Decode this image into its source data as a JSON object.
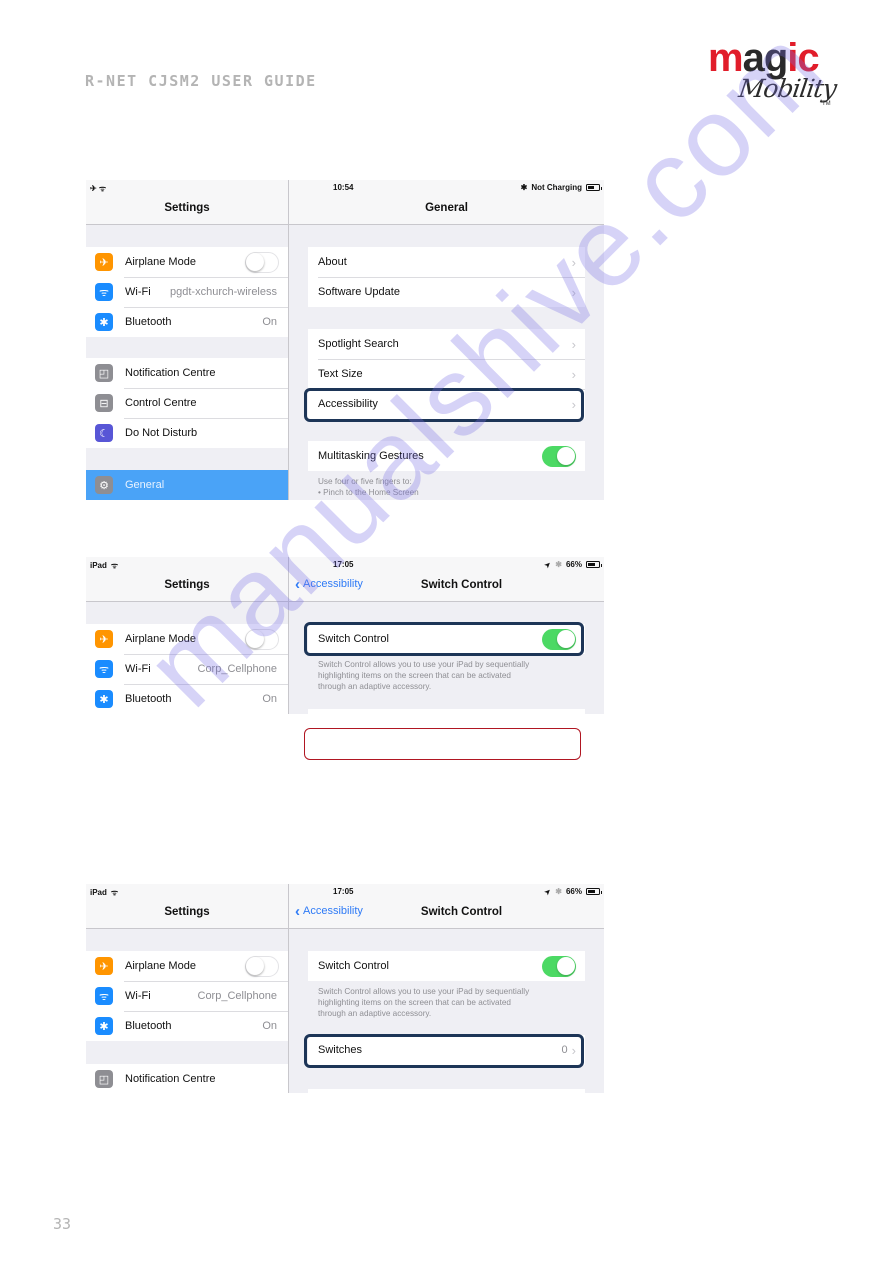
{
  "document": {
    "header_title": "R-NET CJSM2 USER GUIDE",
    "page_number": "33",
    "logo": {
      "word1_a": "m",
      "word1_b": "ag",
      "word1_c": "ic",
      "word2": "Mobility",
      "tm": "TM"
    },
    "watermark": "manualshive.com",
    "colors": {
      "brand_red": "#e11d2a",
      "highlight_navy": "#1d3557",
      "ios_blue": "#2f7bf6",
      "ios_green": "#4cd964",
      "annotation_red": "#b01622"
    }
  },
  "screenshot1": {
    "status": {
      "left_icons": "✈ ᯤ",
      "time": "10:54",
      "bluetooth": "✱",
      "charging": "Not Charging"
    },
    "left": {
      "title": "Settings",
      "group1": [
        {
          "icon": "airplane-icon",
          "glyph": "✈",
          "label": "Airplane Mode",
          "toggle": "off"
        },
        {
          "icon": "wifi-icon",
          "glyph": "ᯤ",
          "label": "Wi-Fi",
          "value": "pgdt-xchurch-wireless"
        },
        {
          "icon": "bluetooth-icon",
          "glyph": "✱",
          "label": "Bluetooth",
          "value": "On"
        }
      ],
      "group2": [
        {
          "icon": "notification-centre-icon",
          "glyph": "◰",
          "label": "Notification Centre"
        },
        {
          "icon": "control-centre-icon",
          "glyph": "⊟",
          "label": "Control Centre"
        },
        {
          "icon": "do-not-disturb-icon",
          "glyph": "☾",
          "label": "Do Not Disturb"
        }
      ],
      "group3": [
        {
          "icon": "general-gear-icon",
          "glyph": "⚙",
          "label": "General",
          "selected": true
        }
      ]
    },
    "right": {
      "title": "General",
      "group1": [
        "About",
        "Software Update"
      ],
      "group2": [
        "Spotlight Search",
        "Text Size",
        "Accessibility"
      ],
      "multitasking": {
        "label": "Multitasking Gestures",
        "toggle": "on"
      },
      "note_lines": [
        "Use four or five fingers to:",
        "• Pinch to the Home Screen"
      ]
    }
  },
  "screenshot2": {
    "status": {
      "left": "iPad",
      "time": "17:05",
      "battery": "66%"
    },
    "left": {
      "title": "Settings",
      "items": [
        {
          "icon": "airplane-icon",
          "glyph": "✈",
          "label": "Airplane Mode",
          "toggle": "off"
        },
        {
          "icon": "wifi-icon",
          "glyph": "ᯤ",
          "label": "Wi-Fi",
          "value": "Corp_Cellphone"
        },
        {
          "icon": "bluetooth-icon",
          "glyph": "✱",
          "label": "Bluetooth",
          "value": "On"
        }
      ]
    },
    "right": {
      "back_label": "Accessibility",
      "title": "Switch Control",
      "switch_control": {
        "label": "Switch Control",
        "toggle": "on"
      },
      "note_lines": [
        "Switch Control allows you to use your iPad by sequentially",
        "highlighting items on the screen that can be activated",
        "through an adaptive accessory."
      ]
    }
  },
  "screenshot3": {
    "status": {
      "left": "iPad",
      "time": "17:05",
      "battery": "66%"
    },
    "left": {
      "title": "Settings",
      "group1": [
        {
          "icon": "airplane-icon",
          "glyph": "✈",
          "label": "Airplane Mode",
          "toggle": "off"
        },
        {
          "icon": "wifi-icon",
          "glyph": "ᯤ",
          "label": "Wi-Fi",
          "value": "Corp_Cellphone"
        },
        {
          "icon": "bluetooth-icon",
          "glyph": "✱",
          "label": "Bluetooth",
          "value": "On"
        }
      ],
      "group2": [
        {
          "icon": "notification-centre-icon",
          "glyph": "◰",
          "label": "Notification Centre"
        }
      ]
    },
    "right": {
      "back_label": "Accessibility",
      "title": "Switch Control",
      "switch_control": {
        "label": "Switch Control",
        "toggle": "on"
      },
      "note_lines": [
        "Switch Control allows you to use your iPad by sequentially",
        "highlighting items on the screen that can be activated",
        "through an adaptive accessory."
      ],
      "switches": {
        "label": "Switches",
        "value": "0"
      }
    }
  },
  "shared": {
    "chevron": "›",
    "back_chevron": "‹",
    "location_arrow": "➤"
  }
}
